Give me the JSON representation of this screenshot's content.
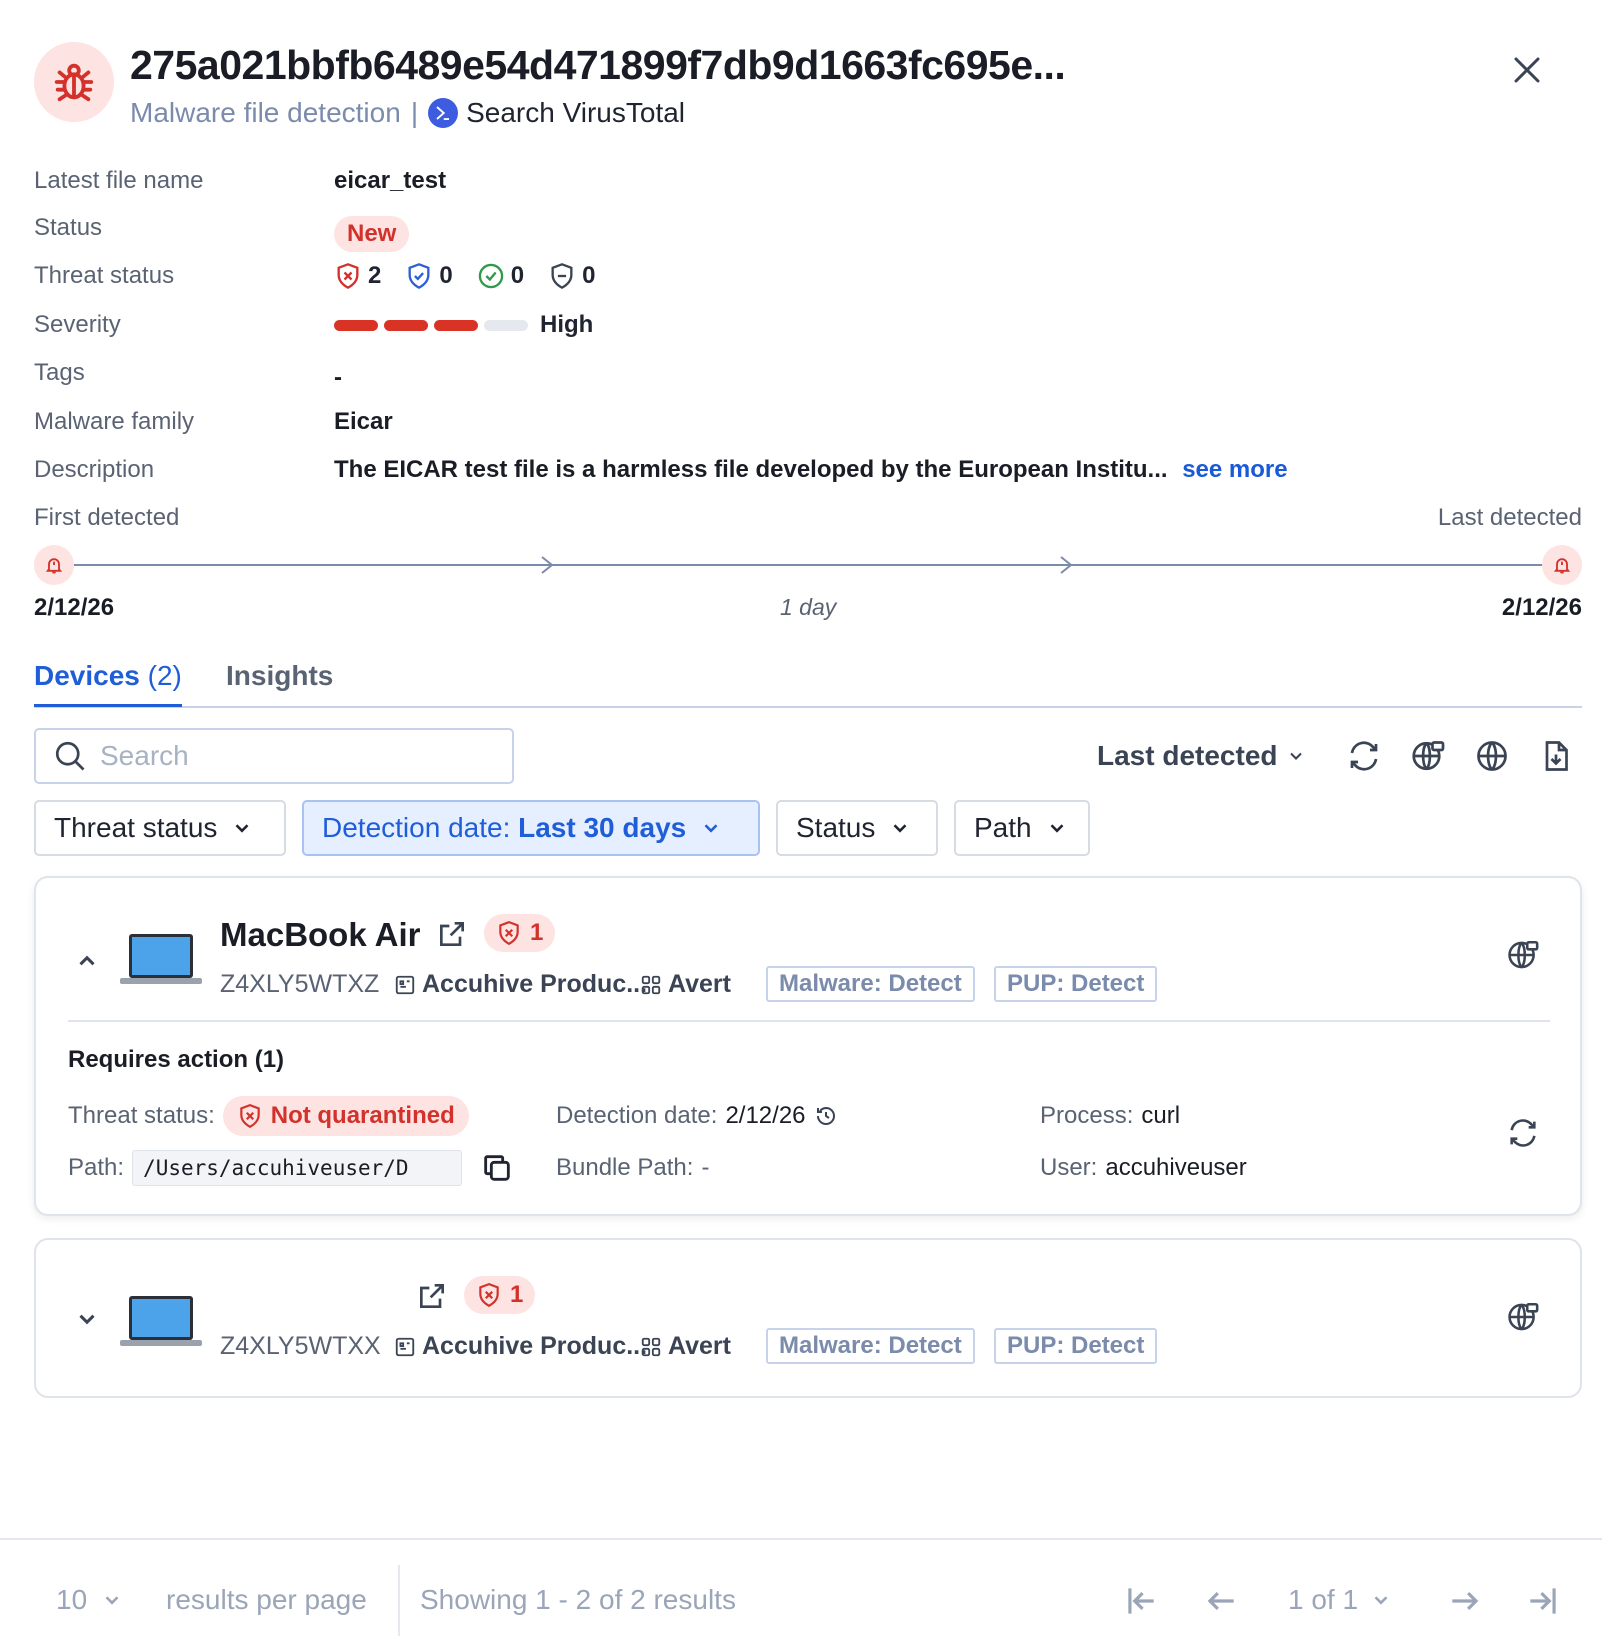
{
  "header": {
    "title": "275a021bbfb6489e54d471899f7db9d1663fc695e...",
    "subtitle": "Malware file detection",
    "subtitle_sep": "|",
    "vt_link": "Search VirusTotal",
    "icon": "bug-icon"
  },
  "details": {
    "latest_file_name": {
      "label": "Latest file name",
      "value": "eicar_test"
    },
    "status": {
      "label": "Status",
      "value": "New"
    },
    "threat_status": {
      "label": "Threat status",
      "counts": [
        {
          "icon": "shield-x-icon",
          "value": "2",
          "color": "#d2322b"
        },
        {
          "icon": "shield-check-icon",
          "value": "0",
          "color": "#2f5fd6"
        },
        {
          "icon": "check-circle-icon",
          "value": "0",
          "color": "#2e9a4a"
        },
        {
          "icon": "shield-minus-icon",
          "value": "0",
          "color": "#3b4455"
        }
      ]
    },
    "severity": {
      "label": "Severity",
      "value": "High",
      "level": 3,
      "max": 4
    },
    "tags": {
      "label": "Tags",
      "value": "-"
    },
    "malware_family": {
      "label": "Malware family",
      "value": "Eicar"
    },
    "description": {
      "label": "Description",
      "value": "The EICAR test file is a harmless file developed by the European Institu...",
      "see_more": "see more"
    }
  },
  "timeline": {
    "first_label": "First detected",
    "last_label": "Last detected",
    "first_date": "2/12/26",
    "last_date": "2/12/26",
    "duration": "1 day"
  },
  "tabs": [
    {
      "label": "Devices",
      "count": "(2)",
      "active": true
    },
    {
      "label": "Insights",
      "active": false
    }
  ],
  "toolbar": {
    "search_placeholder": "Search",
    "sort_label": "Last detected"
  },
  "filters": {
    "threat_status": "Threat status",
    "detection_prefix": "Detection date:",
    "detection_value": "Last 30 days",
    "status": "Status",
    "path": "Path"
  },
  "devices": [
    {
      "name": "MacBook Air",
      "threat_count": "1",
      "serial": "Z4XLY5WTXZ",
      "org": "Accuhive Produc...",
      "policy": "Avert",
      "tags": [
        "Malware: Detect",
        "PUP: Detect"
      ],
      "expanded": true,
      "requires_action": "Requires action (1)",
      "threat_status_label": "Threat status:",
      "threat_status_value": "Not quarantined",
      "detection_date_label": "Detection date:",
      "detection_date_value": "2/12/26",
      "process_label": "Process:",
      "process_value": "curl",
      "path_label": "Path:",
      "path_value": "/Users/accuhiveuser/D",
      "bundle_path_label": "Bundle Path:",
      "bundle_path_value": "-",
      "user_label": "User:",
      "user_value": "accuhiveuser"
    },
    {
      "name": "",
      "threat_count": "1",
      "serial": "Z4XLY5WTXX",
      "org": "Accuhive Produc...",
      "policy": "Avert",
      "tags": [
        "Malware: Detect",
        "PUP: Detect"
      ],
      "expanded": false
    }
  ],
  "footer": {
    "per_page": "10",
    "per_page_label": "results per page",
    "showing": "Showing 1 - 2 of 2 results",
    "page": "1 of 1"
  },
  "colors": {
    "accent": "#1f5ed8",
    "danger": "#d2322b",
    "danger_bg": "#fde3e1"
  }
}
